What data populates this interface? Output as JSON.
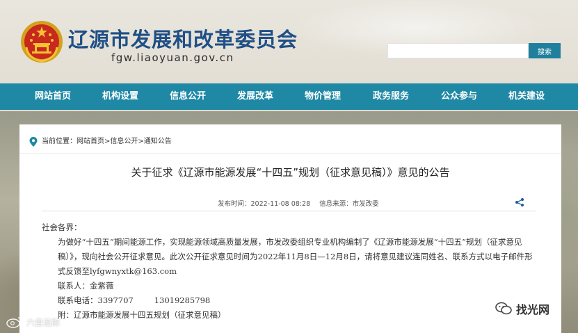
{
  "header": {
    "site_title": "辽源市发展和改革委员会",
    "domain": "fgw.liaoyuan.gov.cn",
    "search_placeholder": "",
    "search_button": "搜索",
    "emblem_icon": "national-emblem-icon"
  },
  "nav": {
    "items": [
      "网站首页",
      "机构设置",
      "信息公开",
      "发展改革",
      "物价管理",
      "政务服务",
      "公众参与",
      "机关建设"
    ]
  },
  "breadcrumb": {
    "prefix": "当前位置：",
    "items": [
      "网站首页",
      "信息公开",
      "通知公告"
    ],
    "separator": ">"
  },
  "article": {
    "title": "关于征求《辽源市能源发展“十四五”规划（征求意见稿）》意见的公告",
    "publish_time": "发布时间：2022-11-08 08:28",
    "source": "信息来源：市发改委",
    "greeting": "社会各界：",
    "paragraph": "为做好“十四五”期间能源工作，实现能源领域高质量发展，市发改委组织专业机构编制了《辽源市能源发展“十四五”规划（征求意见稿）》，现向社会公开征求意见。此次公开征求意见时间为2022年11月8日—12月8日，请将意见建议连同姓名、联系方式以电子邮件形式反馈至lyfgwnyxtk@163.com",
    "contact_label": "联系人：金紫薇",
    "phone_label": "联系电话：3397707",
    "phone_mobile": "13019285798",
    "attachment": "附：辽源市能源发展十四五规划（征求意见稿）"
  },
  "watermarks": {
    "left": "六盘追踪",
    "right": "找光网"
  },
  "colors": {
    "nav_bg": "#1e88a5",
    "title_blue": "#1f4f86",
    "search_btn": "#1f7f9c"
  }
}
